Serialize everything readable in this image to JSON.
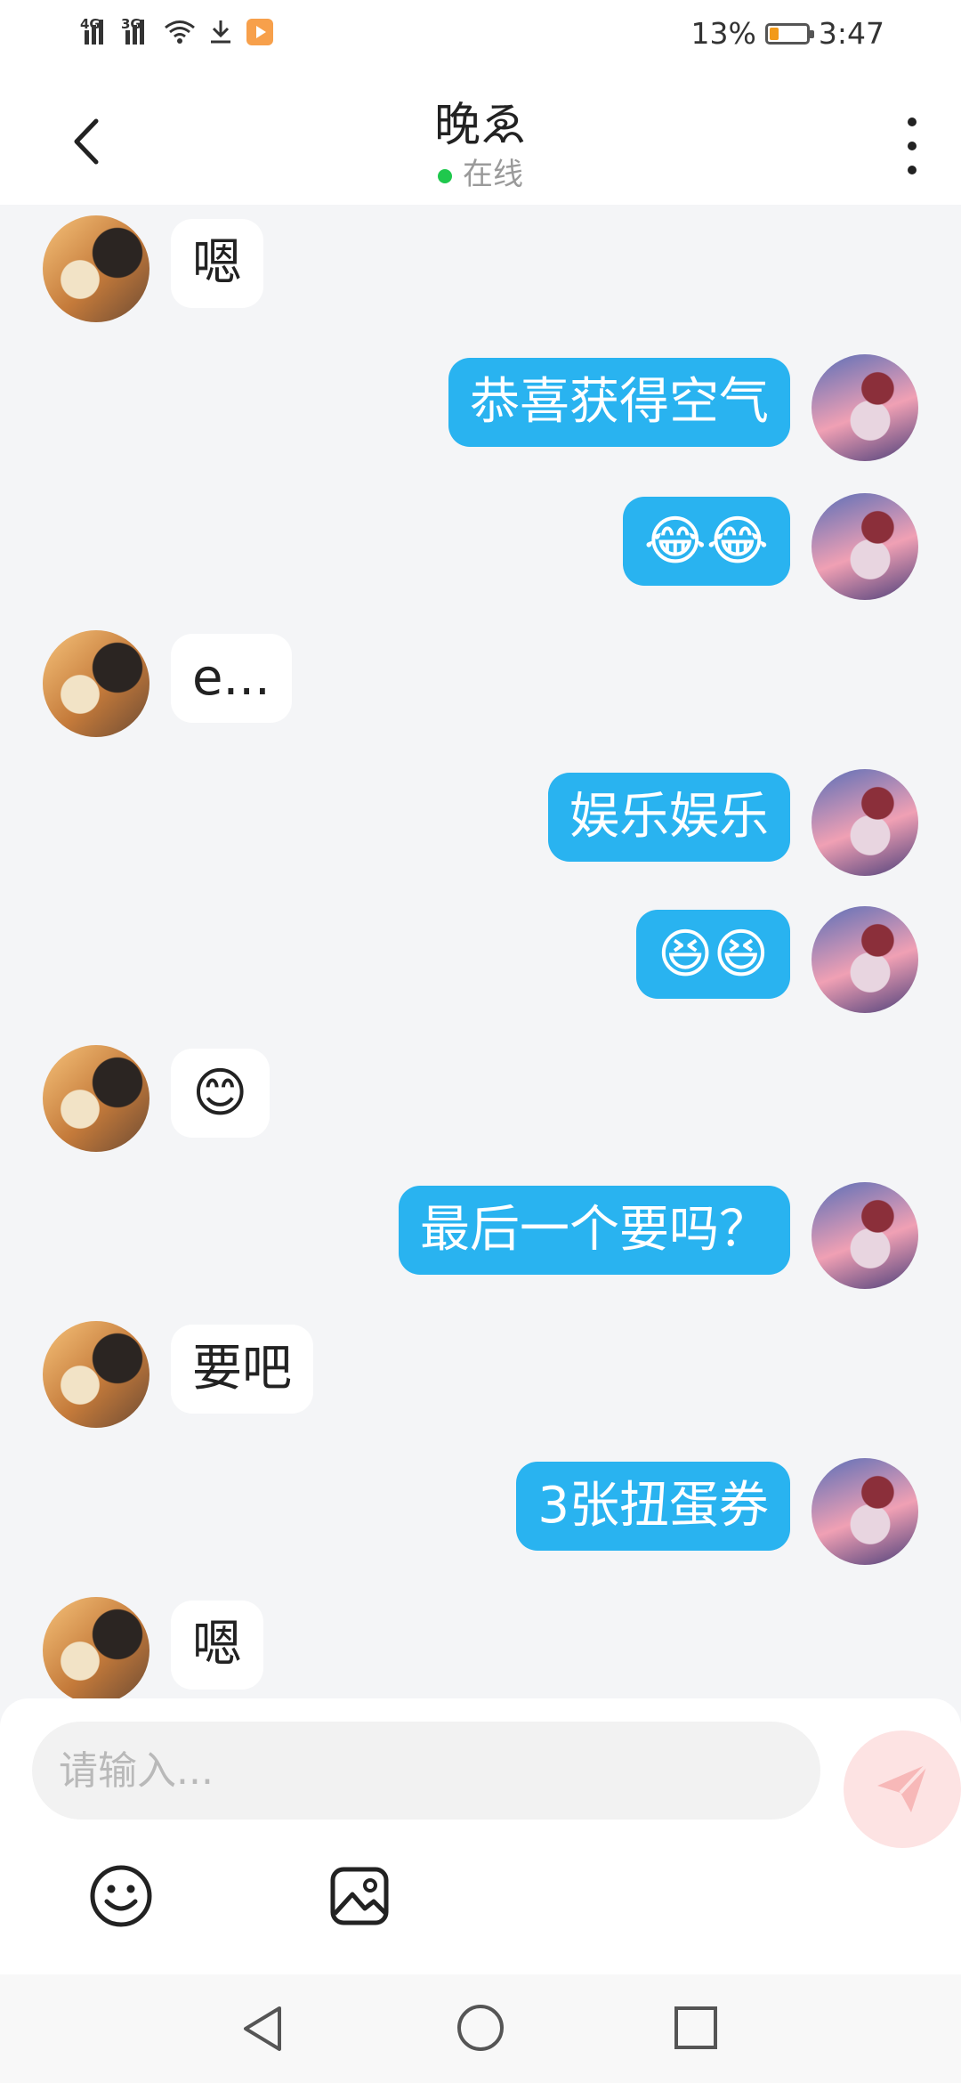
{
  "status_bar": {
    "network_1": "4G",
    "network_2": "3G",
    "battery": "13%",
    "time": "3:47"
  },
  "header": {
    "title": "晚ゑ",
    "status": "在线"
  },
  "messages": [
    {
      "side": "in",
      "text": "嗯"
    },
    {
      "side": "out",
      "text": "恭喜获得空气"
    },
    {
      "side": "out",
      "text": "😂😂"
    },
    {
      "side": "in",
      "text": "e..."
    },
    {
      "side": "out",
      "text": "娱乐娱乐"
    },
    {
      "side": "out",
      "text": "😆😆"
    },
    {
      "side": "in",
      "text": "😊"
    },
    {
      "side": "out",
      "text": "最后一个要吗？"
    },
    {
      "side": "in",
      "text": "要吧"
    },
    {
      "side": "out",
      "text": "3张扭蛋券"
    },
    {
      "side": "in",
      "text": "嗯"
    }
  ],
  "composer": {
    "placeholder": "请输入...",
    "value": ""
  },
  "icons": {
    "back": "chevron-left-icon",
    "more": "more-vertical-icon",
    "send": "send-icon",
    "emoji": "smiley-icon",
    "image": "image-icon"
  },
  "colors": {
    "outgoing_bubble": "#29b3f0",
    "incoming_bubble": "#ffffff",
    "online_dot": "#1fc84d",
    "send_button": "#fde3e3"
  }
}
